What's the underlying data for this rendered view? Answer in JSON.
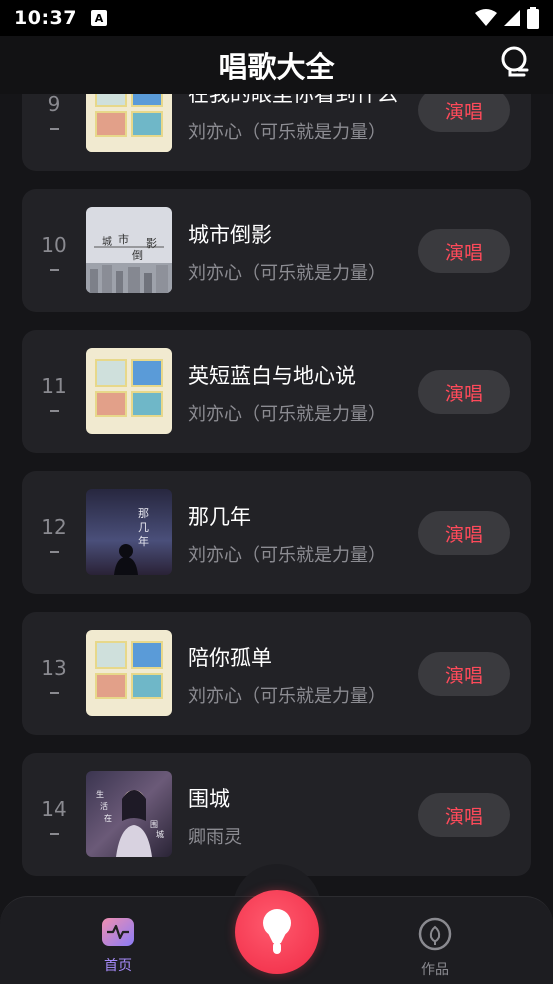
{
  "status_bar": {
    "time": "10:37",
    "badge": "A"
  },
  "header": {
    "title": "唱歌大全"
  },
  "songs": [
    {
      "rank": "9",
      "title": "在我的眼里你看到什么",
      "artist": "刘亦心（可乐就是力量）",
      "action": "演唱"
    },
    {
      "rank": "10",
      "title": "城市倒影",
      "artist": "刘亦心（可乐就是力量）",
      "action": "演唱"
    },
    {
      "rank": "11",
      "title": "英短蓝白与地心说",
      "artist": "刘亦心（可乐就是力量）",
      "action": "演唱"
    },
    {
      "rank": "12",
      "title": "那几年",
      "artist": "刘亦心（可乐就是力量）",
      "action": "演唱"
    },
    {
      "rank": "13",
      "title": "陪你孤单",
      "artist": "刘亦心（可乐就是力量）",
      "action": "演唱"
    },
    {
      "rank": "14",
      "title": "围城",
      "artist": "卿雨灵",
      "action": "演唱"
    }
  ],
  "covers": {
    "city_text": [
      "城",
      "市",
      "倒",
      "影"
    ],
    "nanian_text": [
      "那",
      "几",
      "年"
    ],
    "weicheng_text": [
      "生",
      "活",
      "在",
      "围",
      "城"
    ]
  },
  "bottom_nav": {
    "home_label": "首页",
    "works_label": "作品",
    "active_color": "#a78bfa",
    "inactive_color": "#8a8a90"
  },
  "colors": {
    "accent": "#ff4a5a",
    "card": "#222226",
    "background": "#151518"
  }
}
